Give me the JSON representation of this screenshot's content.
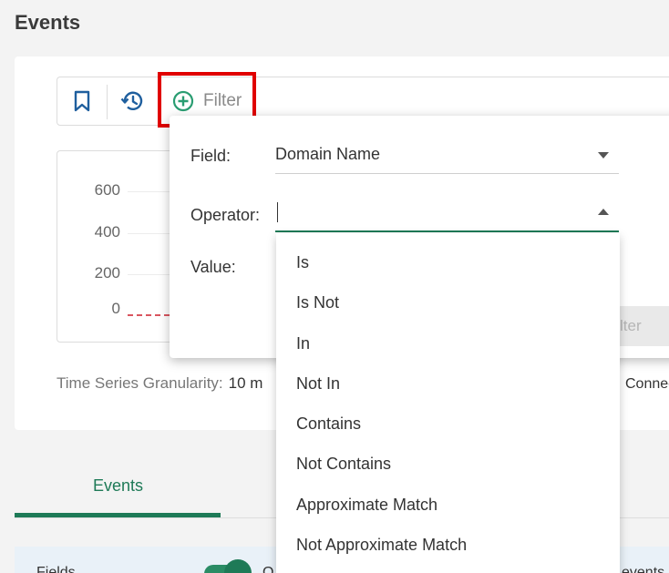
{
  "page": {
    "title": "Events"
  },
  "toolbar": {
    "bookmark_icon": "bookmark-icon",
    "history_icon": "history-icon",
    "filter_icon": "add-circle-icon",
    "filter_label": "Filter"
  },
  "chart": {
    "y_ticks": [
      "600",
      "400",
      "200",
      "0"
    ]
  },
  "granularity": {
    "label": "Time Series Granularity:",
    "value": "10 m"
  },
  "connection": {
    "label": "Connec"
  },
  "tabs": {
    "events_label": "Events"
  },
  "bottom": {
    "fields_label": "Fields",
    "q_text": "Q",
    "events_tail": "events"
  },
  "filter_popup": {
    "field_label": "Field:",
    "field_value": "Domain Name",
    "operator_label": "Operator:",
    "operator_value": "",
    "value_label": "Value:",
    "apply_label": "lter"
  },
  "operator_options": [
    "Is",
    "Is Not",
    "In",
    "Not In",
    "Contains",
    "Not Contains",
    "Approximate Match",
    "Not Approximate Match"
  ],
  "colors": {
    "accent": "#1e7a57",
    "highlight": "#e00000",
    "series": "#d9555f"
  }
}
